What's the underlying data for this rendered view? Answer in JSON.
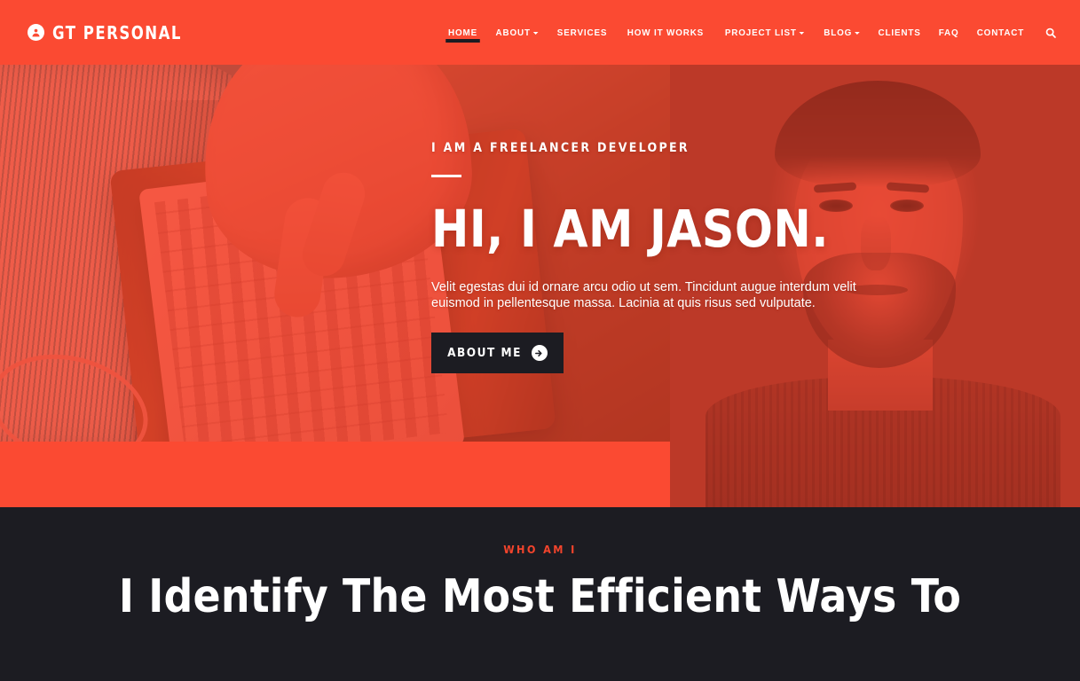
{
  "header": {
    "brand": {
      "text": "GT PERSONAL",
      "icon": "user-circle-icon"
    },
    "nav": [
      {
        "label": "HOME",
        "active": true,
        "caret": false
      },
      {
        "label": "ABOUT",
        "active": false,
        "caret": true
      },
      {
        "label": "SERVICES",
        "active": false,
        "caret": false
      },
      {
        "label": "HOW IT WORKS",
        "active": false,
        "caret": false
      },
      {
        "label": "PROJECT LIST",
        "active": false,
        "caret": true
      },
      {
        "label": "BLOG",
        "active": false,
        "caret": true
      },
      {
        "label": "CLIENTS",
        "active": false,
        "caret": false
      },
      {
        "label": "FAQ",
        "active": false,
        "caret": false
      },
      {
        "label": "CONTACT",
        "active": false,
        "caret": false
      }
    ],
    "search_icon": "search-icon"
  },
  "hero": {
    "subtitle": "I AM A FREELANCER DEVELOPER",
    "title": "HI, I AM JASON.",
    "description": "Velit egestas dui id ornare arcu odio ut sem. Tincidunt augue interdum velit euismod in pellentesque massa. Lacinia at quis risus sed vulputate.",
    "button_label": "ABOUT ME",
    "button_icon": "arrow-right-circle-icon"
  },
  "about": {
    "eyebrow": "WHO AM I",
    "title": "I Identify The Most Efficient Ways To"
  },
  "colors": {
    "brand_orange": "#fb4a32",
    "hero_right_red": "#e8432c",
    "dark": "#1c1c22",
    "accent_text": "#f4442c",
    "white": "#ffffff"
  }
}
